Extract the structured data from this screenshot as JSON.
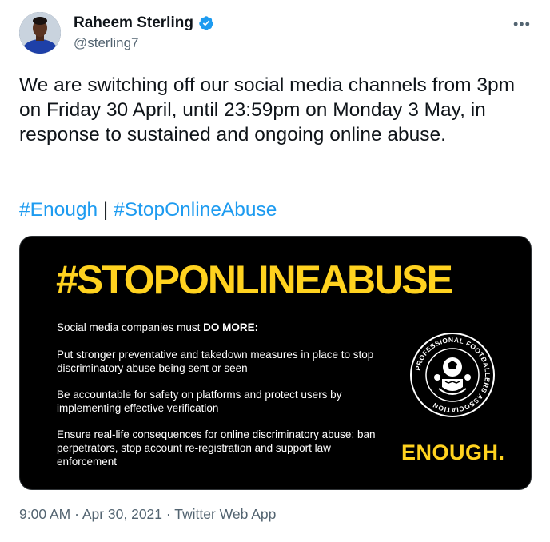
{
  "author": {
    "name": "Raheem Sterling",
    "handle": "@sterling7",
    "verified": true
  },
  "tweet": {
    "text": "We are switching off our social media channels from 3pm on Friday 30 April, until 23:59pm on Monday 3 May, in response to sustained and ongoing online abuse.",
    "hashtags": [
      "#Enough",
      "#StopOnlineAbuse"
    ],
    "separator": " | "
  },
  "card": {
    "heading": "#STOPONLINEABUSE",
    "intro_prefix": "Social media companies must ",
    "intro_bold": "DO MORE:",
    "points": [
      "Put stronger preventative and takedown measures in place to stop discriminatory abuse being sent or seen",
      "Be accountable for safety on platforms and protect users by implementing effective verification",
      "Ensure real-life consequences for online discriminatory abuse: ban perpetrators, stop account re-registration and support law enforcement"
    ],
    "crest_text": "PROFESSIONAL FOOTBALLERS ASSOCIATION",
    "stamp": "ENOUGH."
  },
  "meta": {
    "time": "9:00 AM",
    "date": "Apr 30, 2021",
    "dot": " · ",
    "source": "Twitter Web App"
  },
  "colors": {
    "link": "#1d9bf0",
    "accent_yellow": "#ffd21f",
    "muted": "#536471",
    "verified": "#1d9bf0"
  },
  "icons": {
    "verified": "verified-badge-icon",
    "more": "more-options-icon"
  }
}
